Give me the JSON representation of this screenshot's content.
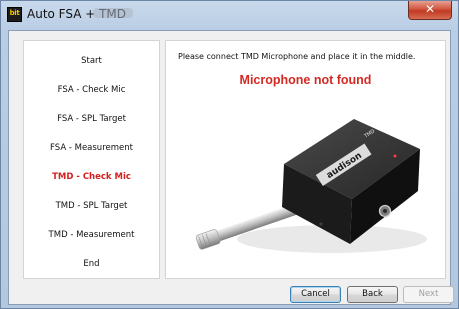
{
  "window": {
    "title": "Auto FSA + TMD",
    "app_icon_text": "bit",
    "close_glyph": "✕"
  },
  "steps": [
    {
      "label": "Start",
      "active": false
    },
    {
      "label": "FSA - Check Mic",
      "active": false
    },
    {
      "label": "FSA - SPL Target",
      "active": false
    },
    {
      "label": "FSA - Measurement",
      "active": false
    },
    {
      "label": "TMD - Check Mic",
      "active": true
    },
    {
      "label": "TMD - SPL Target",
      "active": false
    },
    {
      "label": "TMD - Measurement",
      "active": false
    },
    {
      "label": "End",
      "active": false
    }
  ],
  "content": {
    "instruction": "Please connect TMD Microphone and place it in the middle.",
    "error": "Microphone not found",
    "device_brand": "audison",
    "device_model": "TMD",
    "image_icon": "microphone-device-image"
  },
  "buttons": {
    "cancel": "Cancel",
    "back": "Back",
    "next": "Next"
  },
  "colors": {
    "active_step": "#d41f1f",
    "error_text": "#d42a24",
    "close_button": "#c13a22"
  }
}
